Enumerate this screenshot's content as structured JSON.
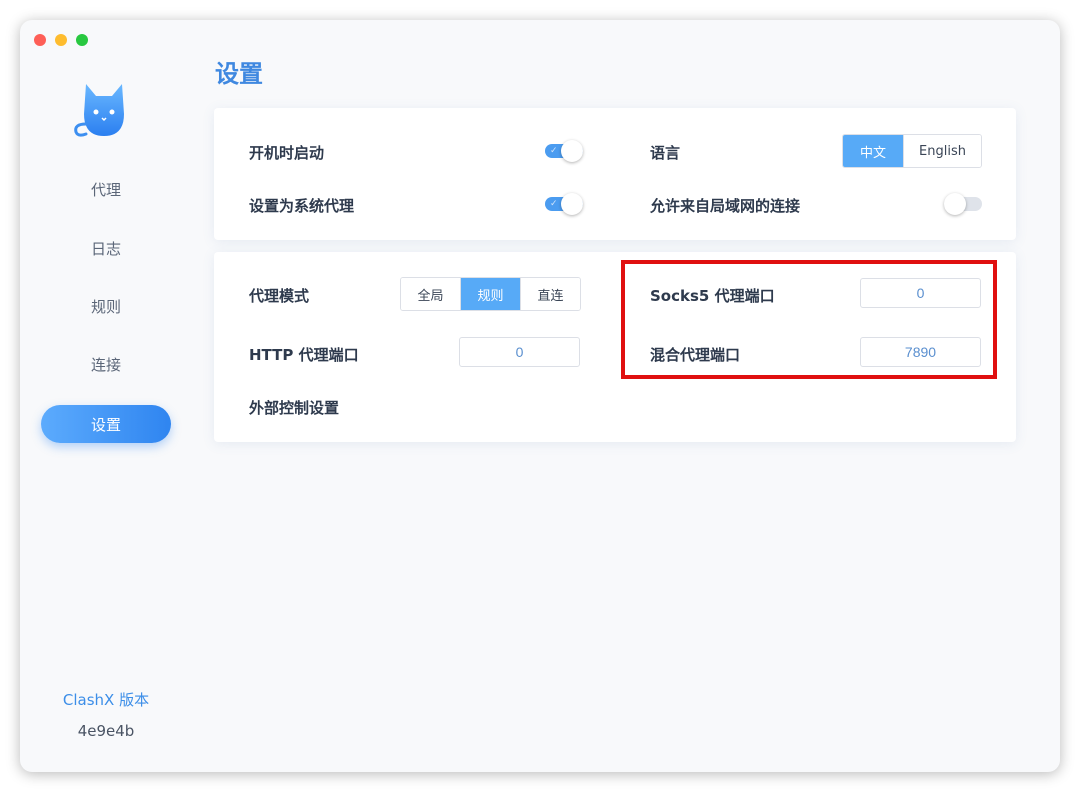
{
  "window": {
    "traffic_lights": [
      "close",
      "minimize",
      "zoom"
    ]
  },
  "sidebar": {
    "logo_icon": "cat-icon",
    "items": [
      {
        "label": "代理",
        "active": false
      },
      {
        "label": "日志",
        "active": false
      },
      {
        "label": "规则",
        "active": false
      },
      {
        "label": "连接",
        "active": false
      },
      {
        "label": "设置",
        "active": true
      }
    ],
    "version_label": "ClashX 版本",
    "version_value": "4e9e4b"
  },
  "page": {
    "title": "设置"
  },
  "general": {
    "start_at_login": {
      "label": "开机时启动",
      "enabled": true
    },
    "system_proxy": {
      "label": "设置为系统代理",
      "enabled": true
    },
    "language": {
      "label": "语言",
      "options": [
        "中文",
        "English"
      ],
      "selected": "中文"
    },
    "allow_lan": {
      "label": "允许来自局域网的连接",
      "enabled": false
    }
  },
  "proxy": {
    "mode": {
      "label": "代理模式",
      "options": [
        "全局",
        "规则",
        "直连"
      ],
      "selected": "规则"
    },
    "http_port": {
      "label": "HTTP 代理端口",
      "value": "0"
    },
    "socks5_port": {
      "label": "Socks5 代理端口",
      "value": "0"
    },
    "mixed_port": {
      "label": "混合代理端口",
      "value": "7890"
    },
    "external_control": {
      "label": "外部控制设置"
    }
  },
  "colors": {
    "accent": "#3f88e0",
    "active_nav": "#2f85f0",
    "highlight_box": "#e01010"
  }
}
